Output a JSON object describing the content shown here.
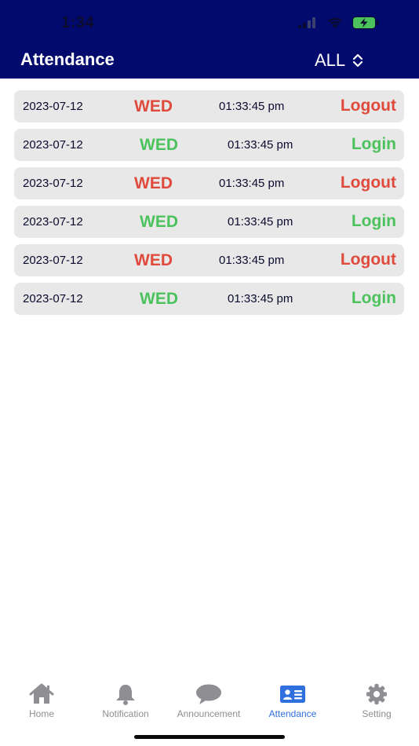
{
  "status_bar": {
    "time": "1:34"
  },
  "header": {
    "title": "Attendance",
    "filter_label": "ALL",
    "filter_icon": "chevron-up-down-icon"
  },
  "colors": {
    "header_bg": "#020a6e",
    "logout": "#e04a3c",
    "login": "#4cc25d",
    "active_tab": "#2f6fde",
    "inactive_tab": "#8e8e93"
  },
  "records": [
    {
      "date": "2023-07-12",
      "day": "WED",
      "time": "01:33:45 pm",
      "type": "Logout"
    },
    {
      "date": "2023-07-12",
      "day": "WED",
      "time": "01:33:45 pm",
      "type": "Login"
    },
    {
      "date": "2023-07-12",
      "day": "WED",
      "time": "01:33:45 pm",
      "type": "Logout"
    },
    {
      "date": "2023-07-12",
      "day": "WED",
      "time": "01:33:45 pm",
      "type": "Login"
    },
    {
      "date": "2023-07-12",
      "day": "WED",
      "time": "01:33:45 pm",
      "type": "Logout"
    },
    {
      "date": "2023-07-12",
      "day": "WED",
      "time": "01:33:45 pm",
      "type": "Login"
    }
  ],
  "tabs": [
    {
      "label": "Home",
      "icon": "home-icon",
      "active": false
    },
    {
      "label": "Notification",
      "icon": "bell-icon",
      "active": false
    },
    {
      "label": "Announcement",
      "icon": "chat-bubble-icon",
      "active": false
    },
    {
      "label": "Attendance",
      "icon": "id-card-icon",
      "active": true
    },
    {
      "label": "Setting",
      "icon": "gear-icon",
      "active": false
    }
  ]
}
